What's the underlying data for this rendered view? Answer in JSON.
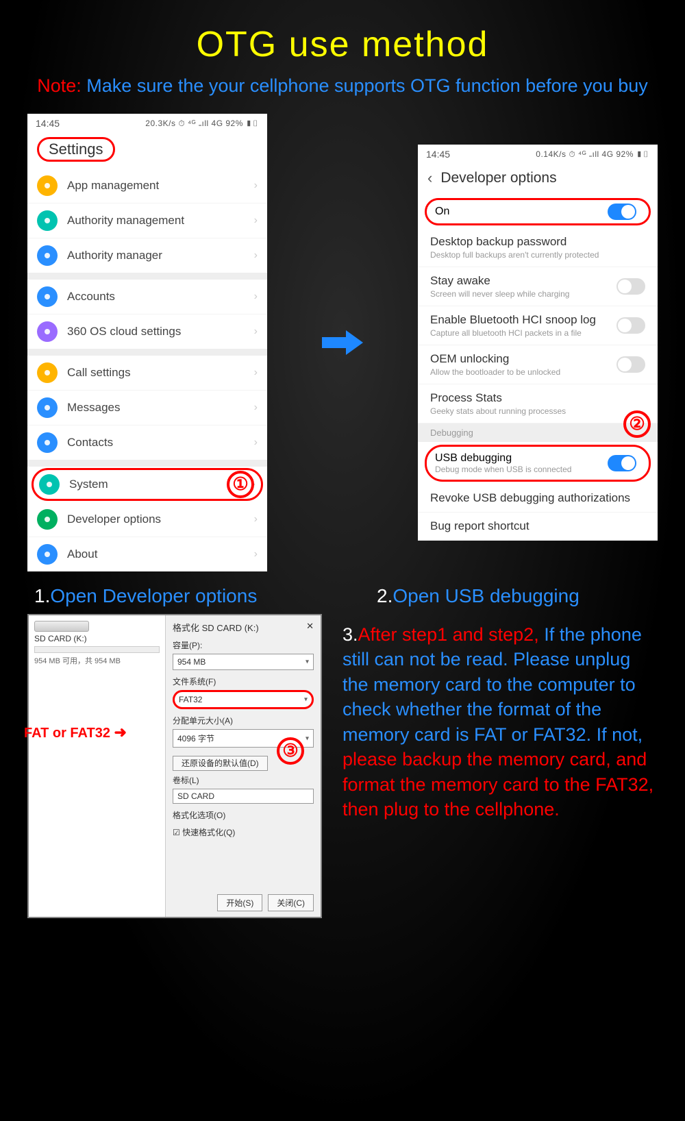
{
  "title": "OTG use method",
  "note_label": "Note:",
  "note_text": "Make sure the your cellphone supports OTG function before you buy",
  "statusbar": {
    "time": "14:45",
    "right1": "20.3K/s ⏱ ⁴ᴳ ₌ıll 4G 92% ▮▯",
    "right2": "0.14K/s ⏱ ⁴ᴳ ₌ıll 4G 92% ▮▯"
  },
  "phone1": {
    "header": "Settings",
    "g1": [
      {
        "label": "App management",
        "color": "#ffb400"
      },
      {
        "label": "Authority management",
        "color": "#00c3b0"
      },
      {
        "label": "Authority manager",
        "color": "#2a8fff"
      }
    ],
    "g2": [
      {
        "label": "Accounts",
        "color": "#2a8fff"
      },
      {
        "label": "360 OS cloud settings",
        "color": "#9a6bff"
      }
    ],
    "g3": [
      {
        "label": "Call settings",
        "color": "#ffb400"
      },
      {
        "label": "Messages",
        "color": "#2a8fff"
      },
      {
        "label": "Contacts",
        "color": "#2a8fff"
      }
    ],
    "g4": [
      {
        "label": "System",
        "color": "#00c3b0",
        "ring": true
      },
      {
        "label": "Developer options",
        "color": "#00b060"
      },
      {
        "label": "About",
        "color": "#2a8fff"
      }
    ],
    "step_num": "①"
  },
  "phone2": {
    "header": "Developer options",
    "on_label": "On",
    "rows": [
      {
        "label": "Desktop backup password",
        "sub": "Desktop full backups aren't currently protected"
      },
      {
        "label": "Stay awake",
        "sub": "Screen will never sleep while charging",
        "toggle": "off"
      },
      {
        "label": "Enable Bluetooth HCI snoop log",
        "sub": "Capture all bluetooth HCI packets in a file",
        "toggle": "off"
      },
      {
        "label": "OEM unlocking",
        "sub": "Allow the bootloader to be unlocked",
        "toggle": "off"
      },
      {
        "label": "Process Stats",
        "sub": "Geeky stats about running processes"
      }
    ],
    "category": "Debugging",
    "usb": {
      "label": "USB debugging",
      "sub": "Debug mode when USB is connected"
    },
    "revoke": "Revoke USB debugging authorizations",
    "bug": "Bug report shortcut",
    "step_num": "②"
  },
  "caption1_num": "1.",
  "caption1_text": "Open Developer options",
  "caption2_num": "2.",
  "caption2_text": "Open USB debugging",
  "windows": {
    "left_title": "SD CARD (K:)",
    "left_sub": "954 MB 可用，共 954 MB",
    "right_title": "格式化 SD CARD (K:)",
    "close": "✕",
    "capacity_label": "容量(P):",
    "capacity_value": "954 MB",
    "fs_label": "文件系统(F)",
    "fs_value": "FAT32",
    "alloc_label": "分配单元大小(A)",
    "alloc_value": "4096 字节",
    "restore_btn": "还原设备的默认值(D)",
    "volume_label": "卷标(L)",
    "volume_value": "SD CARD",
    "options_label": "格式化选项(O)",
    "quick_label": "快速格式化(Q)",
    "start_btn": "开始(S)",
    "close_btn": "关闭(C)",
    "step_num": "③"
  },
  "fat_label": "FAT or FAT32",
  "step3": {
    "num": "3.",
    "red1": "After step1 and step2,",
    "blue1": "If the phone still can not be read. Please unplug the memory card to the computer to check whether the format of the memory card is FAT or FAT32. If not,",
    "red2": "please backup the memory card, and format the memory card to the FAT32, then plug to the cellphone."
  }
}
